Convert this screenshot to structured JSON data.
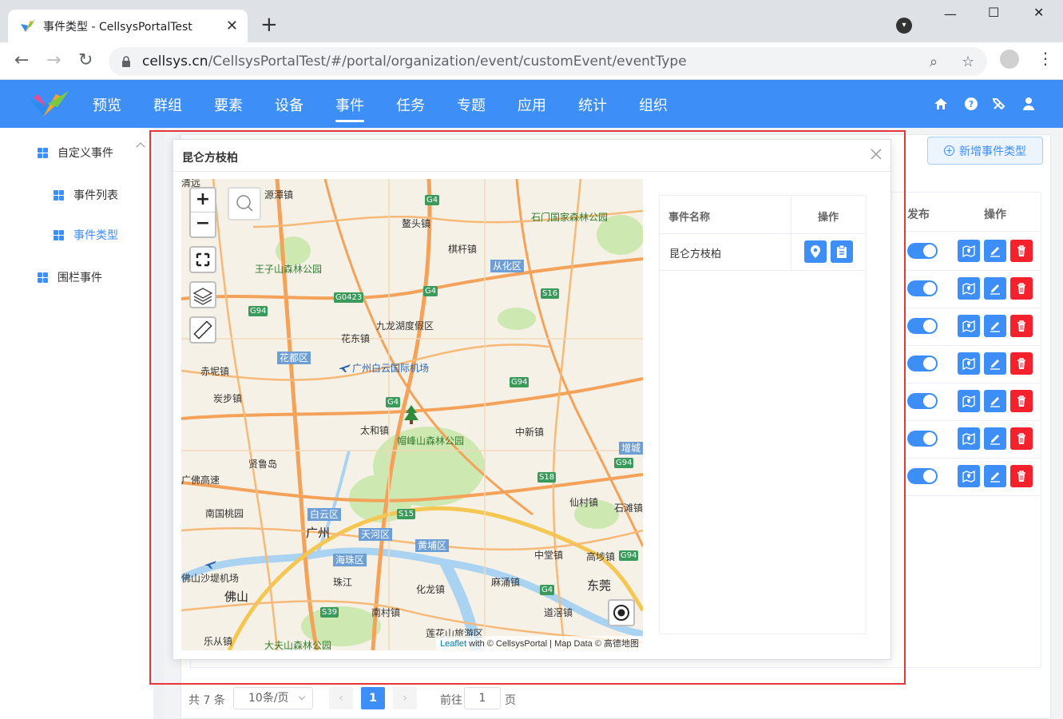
{
  "browser": {
    "tab_title": "事件类型 - CellsysPortalTest",
    "url_host": "cellsys.cn",
    "url_path": "/CellsysPortalTest/#/portal/organization/event/customEvent/eventType"
  },
  "app": {
    "nav": [
      "预览",
      "群组",
      "要素",
      "设备",
      "事件",
      "任务",
      "专题",
      "应用",
      "统计",
      "组织"
    ],
    "active_nav": "事件",
    "accent_color": "#3e8ef7"
  },
  "sidebar": {
    "group_label": "自定义事件",
    "items": [
      {
        "label": "事件列表"
      },
      {
        "label": "事件类型"
      }
    ],
    "fence_label": "围栏事件"
  },
  "toolbar": {
    "add_label": "新增事件类型"
  },
  "table": {
    "headers": {
      "publish": "发布",
      "actions": "操作"
    },
    "row_count_visible": 7
  },
  "pagination": {
    "total_label": "共 7 条",
    "page_size": "10条/页",
    "current_page": "1",
    "goto_prefix": "前往",
    "goto_value": "1",
    "goto_suffix": "页"
  },
  "dialog": {
    "title": "昆仑方枝柏",
    "side_table": {
      "header_name": "事件名称",
      "header_action": "操作",
      "row_name": "昆仑方枝柏"
    },
    "map": {
      "attribution_leaflet": "Leaflet",
      "attribution_rest": " with © CellsysPortal | Map Data © 高德地图",
      "labels": {
        "l1": "源潭镇",
        "l2": "G4",
        "l3": "鳌头镇",
        "l4": "石门国家森林公园",
        "l5": "王子山森林公园",
        "l6": "棋杆镇",
        "l7": "从化区",
        "l8": "G0423",
        "l9": "G4",
        "l10": "S16",
        "l11": "G94",
        "l12": "九龙湖度假区",
        "l13": "花东镇",
        "l14": "花都区",
        "l15": "广州白云国际机场",
        "l16": "赤坭镇",
        "l17": "炭步镇",
        "l18": "G94",
        "l19": "G4",
        "l20": "太和镇",
        "l21": "帽峰山森林公园",
        "l22": "中新镇",
        "l23": "增城",
        "l24": "G94",
        "l25": "贤鲁岛",
        "l26": "广佛高速",
        "l27": "S18",
        "l28": "南国桃园",
        "l29": "白云区",
        "l30": "S15",
        "l31": "仙村镇",
        "l32": "石滩镇",
        "l33": "广州",
        "l34": "天河区",
        "l35": "黄埔区",
        "l36": "中堂镇",
        "l37": "高埗镇",
        "l38": "G94",
        "l39": "佛山沙堤机场",
        "l40": "海珠区",
        "l41": "珠江",
        "l42": "麻涌镇",
        "l43": "化龙镇",
        "l44": "G4",
        "l45": "东莞",
        "l46": "佛山",
        "l47": "S39",
        "l48": "南村镇",
        "l49": "道滘镇",
        "l50": "乐从镇",
        "l51": "大夫山森林公园",
        "l52": "莲花山旅游区",
        "l53": "清远"
      }
    }
  }
}
